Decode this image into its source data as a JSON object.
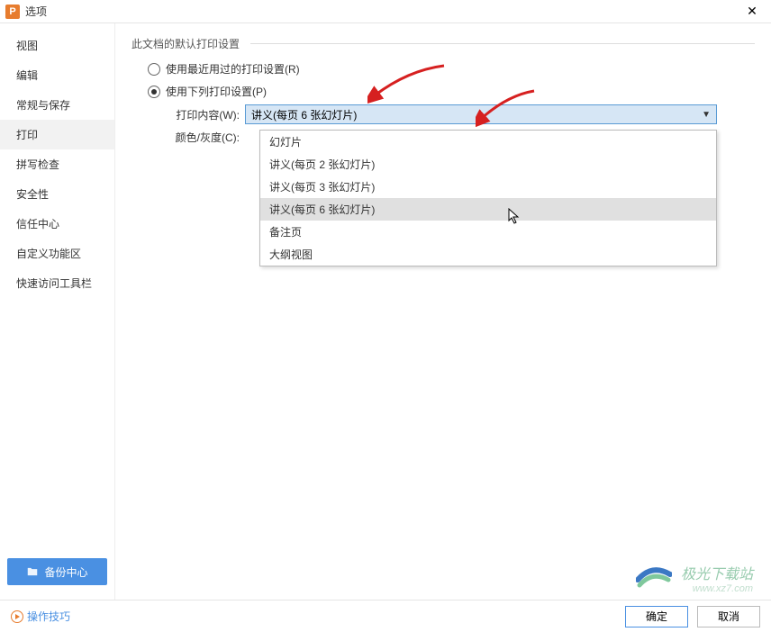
{
  "window": {
    "title": "选项"
  },
  "sidebar": {
    "items": [
      {
        "label": "视图"
      },
      {
        "label": "编辑"
      },
      {
        "label": "常规与保存"
      },
      {
        "label": "打印"
      },
      {
        "label": "拼写检查"
      },
      {
        "label": "安全性"
      },
      {
        "label": "信任中心"
      },
      {
        "label": "自定义功能区"
      },
      {
        "label": "快速访问工具栏"
      }
    ],
    "activeIndex": 3,
    "backup_label": "备份中心"
  },
  "main": {
    "fieldset_title": "此文档的默认打印设置",
    "radio_recent": "使用最近用过的打印设置(R)",
    "radio_following": "使用下列打印设置(P)",
    "selected_radio": 1,
    "label_content": "打印内容(W):",
    "label_color": "颜色/灰度(C):",
    "combo_value": "讲义(每页 6 张幻灯片)",
    "dropdown": [
      "幻灯片",
      "讲义(每页 2 张幻灯片)",
      "讲义(每页 3 张幻灯片)",
      "讲义(每页 6 张幻灯片)",
      "备注页",
      "大纲视图"
    ],
    "dropdown_hover_index": 3
  },
  "footer": {
    "tips_label": "操作技巧",
    "ok_label": "确定",
    "cancel_label": "取消"
  },
  "watermark": {
    "line1": "极光下载站",
    "line2": "www.xz7.com"
  }
}
